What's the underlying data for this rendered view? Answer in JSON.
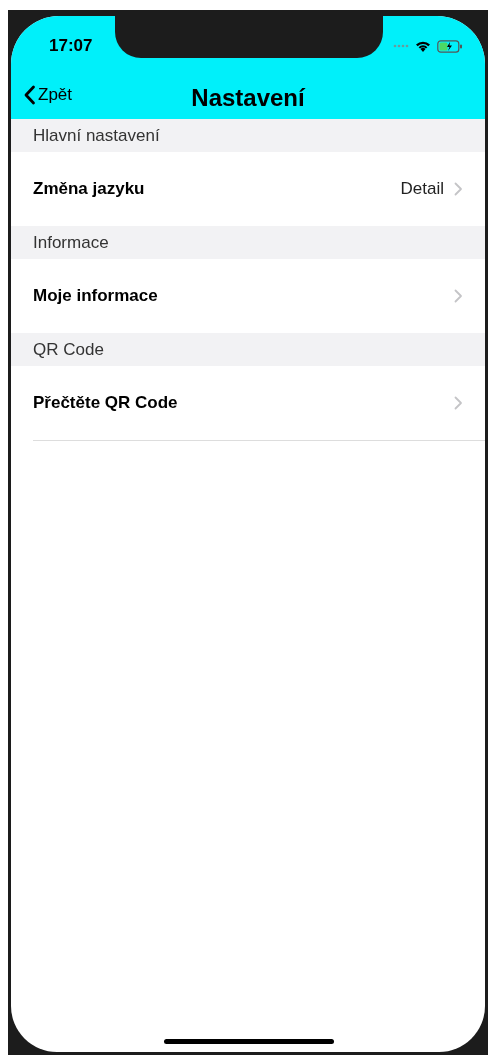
{
  "status_bar": {
    "time": "17:07"
  },
  "nav": {
    "back_label": "Zpět",
    "title": "Nastavení"
  },
  "sections": [
    {
      "header": "Hlavní nastavení",
      "rows": [
        {
          "label": "Změna jazyku",
          "detail": "Detail"
        }
      ]
    },
    {
      "header": "Informace",
      "rows": [
        {
          "label": "Moje informace"
        }
      ]
    },
    {
      "header": "QR Code",
      "rows": [
        {
          "label": "Přečtěte QR Code"
        }
      ]
    }
  ]
}
